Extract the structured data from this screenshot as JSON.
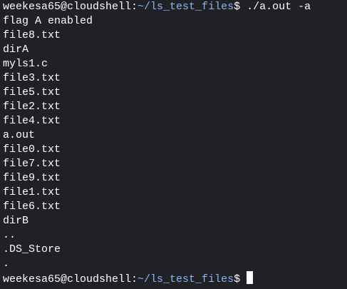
{
  "prompt": {
    "user_host": "weekesa65@cloudshell",
    "sep": ":",
    "path": "~/ls_test_files",
    "dollar": "$",
    "command": " ./a.out -a"
  },
  "output_lines": [
    "flag A enabled",
    "file8.txt",
    "dirA",
    "myls1.c",
    "file3.txt",
    "file5.txt",
    "file2.txt",
    "file4.txt",
    "a.out",
    "file0.txt",
    "file7.txt",
    "file9.txt",
    "file1.txt",
    "file6.txt",
    "dirB",
    "..",
    ".DS_Store",
    "."
  ],
  "prompt_final": {
    "user_host": "weekesa65@cloudshell",
    "sep": ":",
    "path": "~/ls_test_files",
    "dollar": "$"
  },
  "colors": {
    "background": "#202124",
    "text": "#ffffff",
    "path": "#8ab4f8"
  }
}
